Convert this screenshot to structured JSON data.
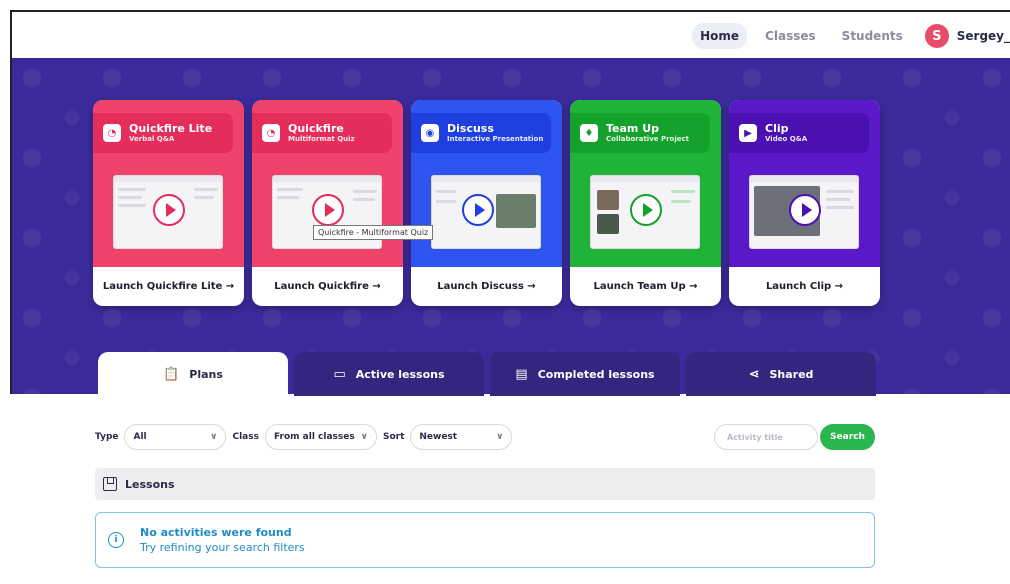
{
  "nav": {
    "items": [
      {
        "label": "Home",
        "active": true
      },
      {
        "label": "Classes",
        "active": false
      },
      {
        "label": "Students",
        "active": false
      }
    ],
    "user": {
      "initial": "S",
      "name": "Sergey_"
    }
  },
  "cards": [
    {
      "title": "Quickfire Lite",
      "subtitle": "Verbal Q&A",
      "launch": "Launch Quickfire Lite →",
      "color": "#f0436c",
      "head_color": "#e42d5b",
      "icon": "timer-icon"
    },
    {
      "title": "Quickfire",
      "subtitle": "Multiformat Quiz",
      "launch": "Launch Quickfire →",
      "color": "#f0436c",
      "head_color": "#e42d5b",
      "icon": "timer-icon"
    },
    {
      "title": "Discuss",
      "subtitle": "Interactive Presentation",
      "launch": "Launch Discuss →",
      "color": "#2f55f0",
      "head_color": "#1f3fe0",
      "icon": "discuss-icon"
    },
    {
      "title": "Team Up",
      "subtitle": "Collaborative Project",
      "launch": "Launch Team Up →",
      "color": "#1fb33a",
      "head_color": "#14a12c",
      "icon": "team-icon"
    },
    {
      "title": "Clip",
      "subtitle": "Video Q&A",
      "launch": "Launch Clip →",
      "color": "#5b18c8",
      "head_color": "#4a10b2",
      "icon": "clip-icon"
    }
  ],
  "tooltip": "Quickfire - Multiformat Quiz",
  "tabs": [
    {
      "label": "Plans",
      "active": true,
      "icon": "clipboard-icon"
    },
    {
      "label": "Active lessons",
      "active": false,
      "icon": "presentation-icon"
    },
    {
      "label": "Completed lessons",
      "active": false,
      "icon": "archive-icon"
    },
    {
      "label": "Shared",
      "active": false,
      "icon": "share-icon"
    }
  ],
  "filters": {
    "type_label": "Type",
    "type_value": "All",
    "class_label": "Class",
    "class_value": "From all classes",
    "sort_label": "Sort",
    "sort_value": "Newest",
    "search_placeholder": "Activity title",
    "search_button": "Search"
  },
  "section": {
    "label": "Lessons"
  },
  "notice": {
    "title": "No activities were found",
    "subtitle": "Try refining your search filters"
  }
}
